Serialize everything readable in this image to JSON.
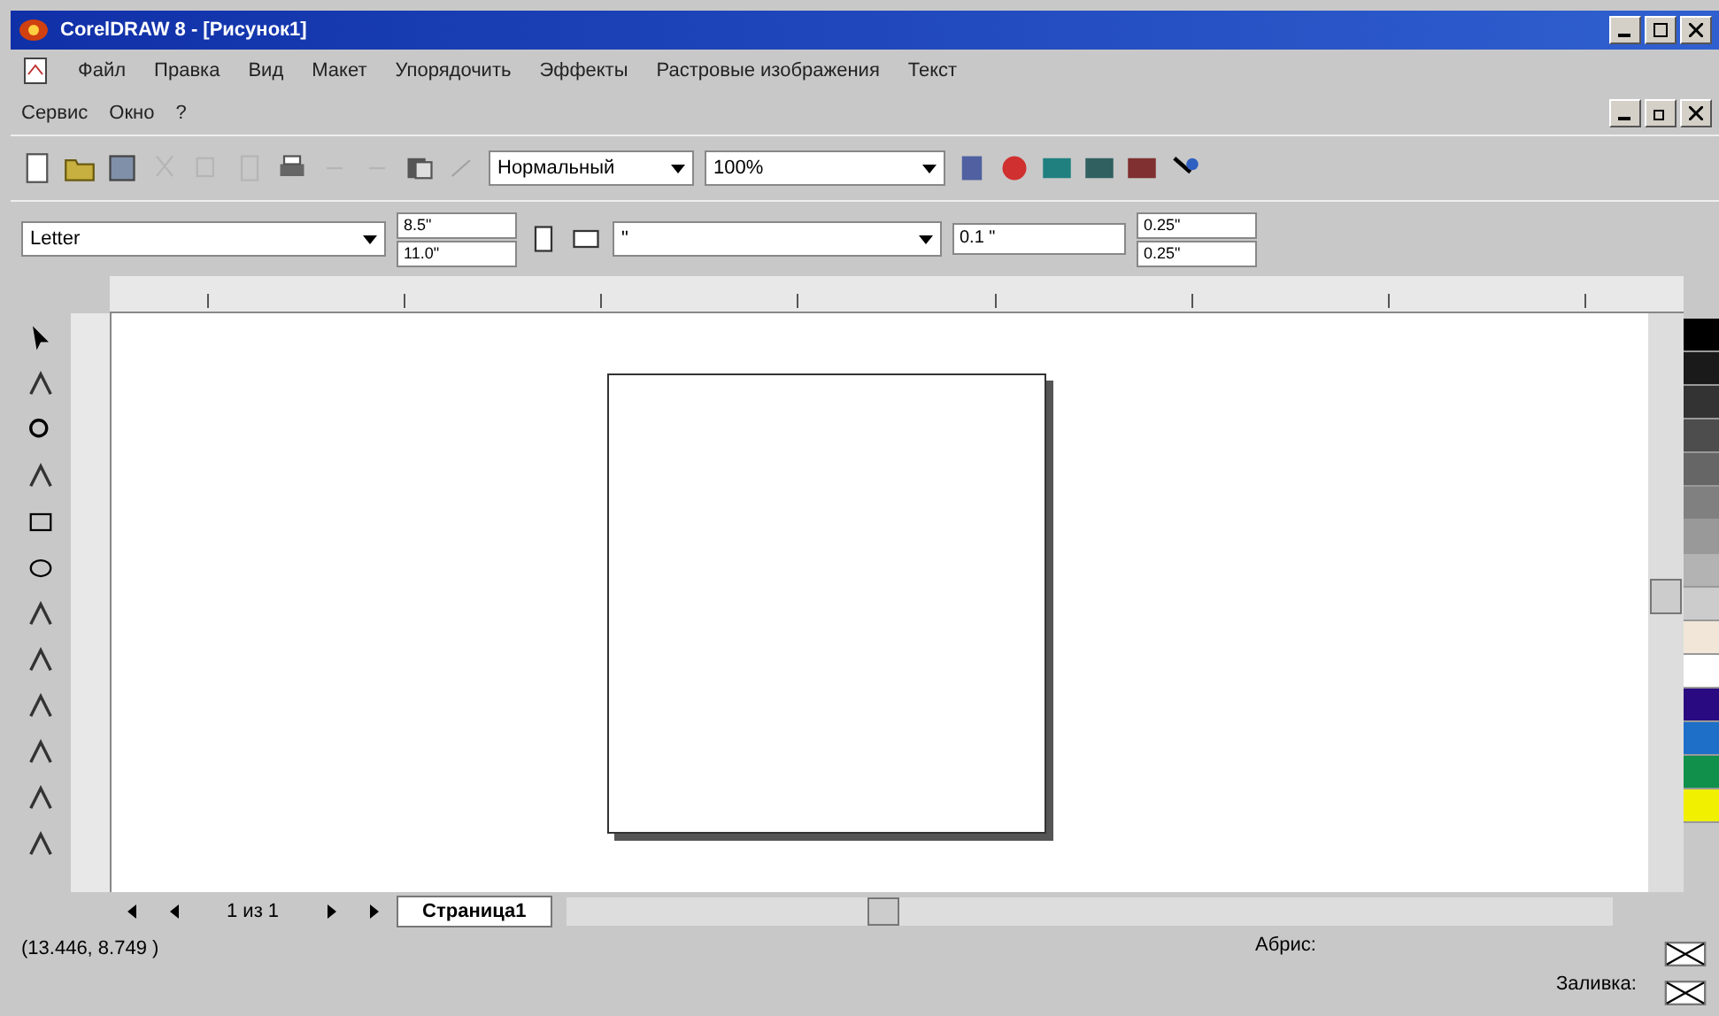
{
  "window": {
    "title": "CorelDRAW 8 - [Рисунок1]"
  },
  "menu": [
    "Файл",
    "Правка",
    "Вид",
    "Макет",
    "Упорядочить",
    "Эффекты",
    "Растровые изображения",
    "Текст"
  ],
  "menu_row2": [
    "Сервис",
    "Окно",
    "?"
  ],
  "toolbar": {
    "view_mode": "Нормальный",
    "zoom": "100%"
  },
  "property_bar": {
    "paper": "Letter",
    "width": "8.5\"",
    "height": "11.0\"",
    "units": "\"",
    "nudge": "0.1 \"",
    "dup_x": "0.25\"",
    "dup_y": "0.25\""
  },
  "palette": [
    {
      "color": "#000000"
    },
    {
      "color": "#1a1a1a"
    },
    {
      "color": "#333333"
    },
    {
      "color": "#4d4d4d"
    },
    {
      "color": "#666666"
    },
    {
      "color": "#808080"
    },
    {
      "color": "#999999"
    },
    {
      "color": "#b3b3b3"
    },
    {
      "color": "#cccccc"
    },
    {
      "color": "#f2e6d9"
    },
    {
      "color": "#ffffff"
    },
    {
      "color": "#2a0a80"
    },
    {
      "color": "#1e6fc8"
    },
    {
      "color": "#10904a"
    },
    {
      "color": "#f0f000"
    }
  ],
  "page_tabs": {
    "counter": "1 из 1",
    "tabs": [
      {
        "label": "Страница1",
        "selected": true
      }
    ]
  },
  "status_bar": {
    "coords": "(13.446, 8.749 )",
    "outline": "Абрис:",
    "fill": "Заливка:"
  }
}
